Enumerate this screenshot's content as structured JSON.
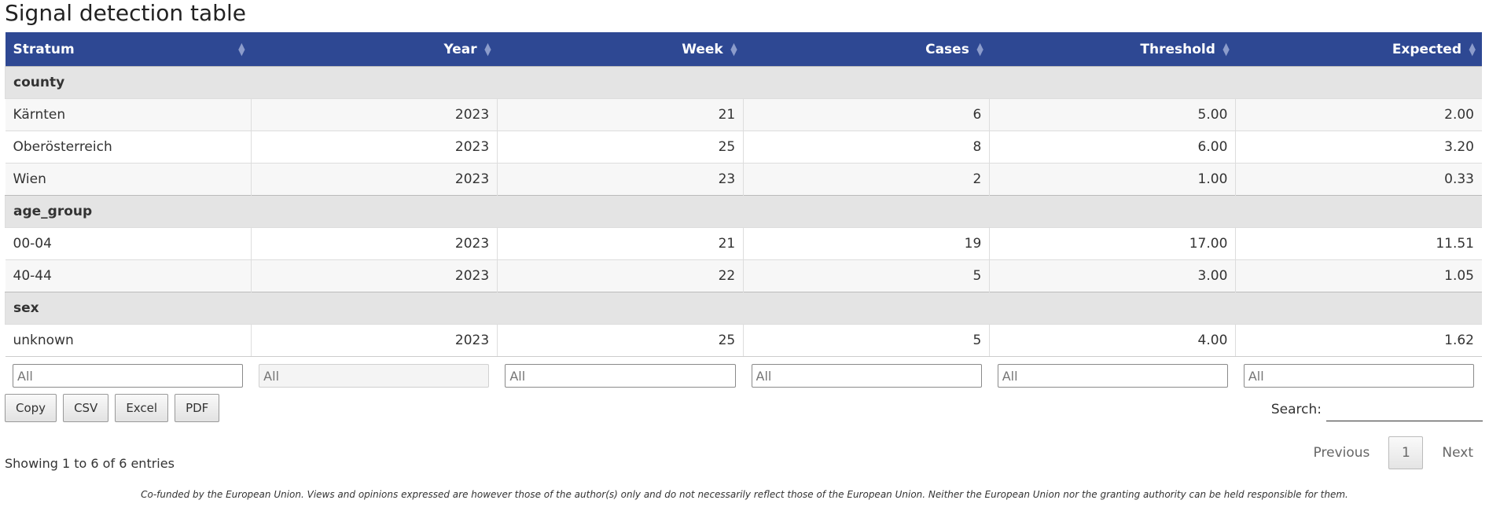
{
  "title": "Signal detection table",
  "columns": [
    "Stratum",
    "Year",
    "Week",
    "Cases",
    "Threshold",
    "Expected"
  ],
  "rows": [
    {
      "group": "county"
    },
    {
      "cells": [
        "Kärnten",
        "2023",
        "21",
        "6",
        "5.00",
        "2.00"
      ]
    },
    {
      "cells": [
        "Oberösterreich",
        "2023",
        "25",
        "8",
        "6.00",
        "3.20"
      ]
    },
    {
      "cells": [
        "Wien",
        "2023",
        "23",
        "2",
        "1.00",
        "0.33"
      ]
    },
    {
      "group": "age_group"
    },
    {
      "cells": [
        "00-04",
        "2023",
        "21",
        "19",
        "17.00",
        "11.51"
      ]
    },
    {
      "cells": [
        "40-44",
        "2023",
        "22",
        "5",
        "3.00",
        "1.05"
      ]
    },
    {
      "group": "sex"
    },
    {
      "cells": [
        "unknown",
        "2023",
        "25",
        "5",
        "4.00",
        "1.62"
      ]
    }
  ],
  "filters": [
    "All",
    "All",
    "All",
    "All",
    "All",
    "All"
  ],
  "buttons": [
    "Copy",
    "CSV",
    "Excel",
    "PDF"
  ],
  "search_label": "Search:",
  "info": "Showing 1 to 6 of 6 entries",
  "pager": {
    "previous": "Previous",
    "page": "1",
    "next": "Next"
  },
  "footer": "Co-funded by the European Union. Views and opinions expressed are however those of the author(s) only and do not necessarily reflect those of the European Union. Neither the European Union nor the granting authority can be held responsible for them.",
  "colors": {
    "header_bg": "#2e4893",
    "group_bg": "#e4e4e4"
  }
}
